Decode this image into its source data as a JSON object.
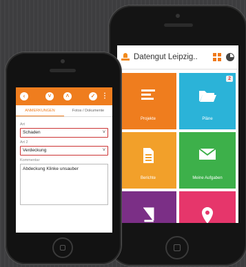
{
  "right_app": {
    "title": "Datengut Leipzig..",
    "tiles": [
      {
        "label": "Projekte",
        "icon": "list-icon",
        "color": "#ef7d1e"
      },
      {
        "label": "Pläne",
        "icon": "folder-open-icon",
        "color": "#2bb3d8",
        "badge": "2"
      },
      {
        "label": "Berichte",
        "icon": "document-icon",
        "color": "#f2a02a"
      },
      {
        "label": "Meine Aufgaben",
        "icon": "mail-icon",
        "color": "#3db04a"
      },
      {
        "label": "",
        "icon": "book-icon",
        "color": "#7b2f86"
      },
      {
        "label": "",
        "icon": "location-pin-icon",
        "color": "#e6366b"
      }
    ]
  },
  "left_app": {
    "toolbar": {
      "back": "‹",
      "down": "˅",
      "up": "˄",
      "check": "✓",
      "more": "⋮"
    },
    "tabs": [
      "ANMERKUNGEN",
      "Fotos / Dokumente"
    ],
    "fields": {
      "art_label": "Art",
      "art_value": "Schaden",
      "art2_label": "Art 2",
      "art2_value": "Verdeckung",
      "comment_label": "Kommentar",
      "comment_value": "Abdeckung Klinke unsauber"
    }
  }
}
